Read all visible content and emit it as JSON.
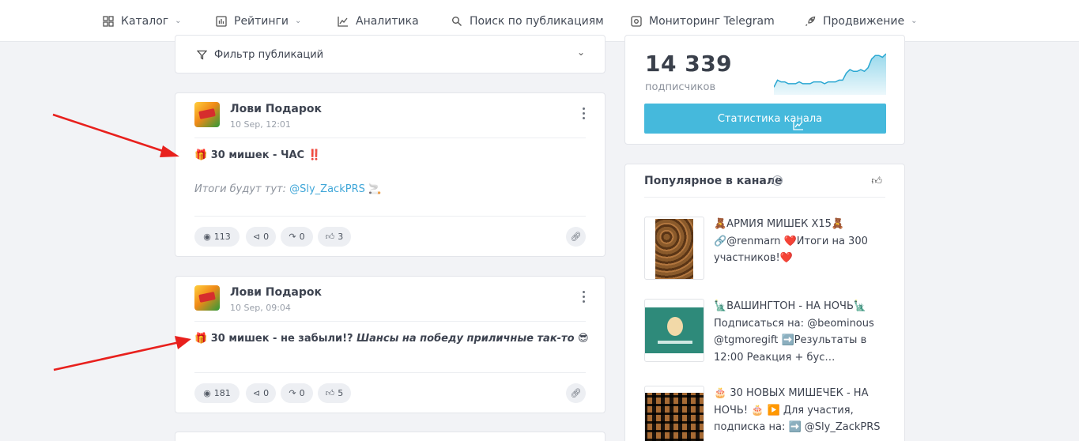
{
  "nav": {
    "items": [
      {
        "label": "Каталог",
        "icon": "grid-icon",
        "has_dropdown": true
      },
      {
        "label": "Рейтинги",
        "icon": "bar-chart-icon",
        "has_dropdown": true
      },
      {
        "label": "Аналитика",
        "icon": "line-chart-icon",
        "has_dropdown": false
      },
      {
        "label": "Поиск по публикациям",
        "icon": "search-icon",
        "has_dropdown": false
      },
      {
        "label": "Мониторинг Telegram",
        "icon": "monitor-icon",
        "has_dropdown": false
      },
      {
        "label": "Продвижение",
        "icon": "rocket-icon",
        "has_dropdown": true
      }
    ]
  },
  "filter": {
    "label": "Фильтр публикаций"
  },
  "posts": [
    {
      "channel": "Лови Подарок",
      "date": "10 Sep, 12:01",
      "line1_emoji": "🎁",
      "line1_text": "30 мишек - ЧАС",
      "line1_suffix": "‼️",
      "line2_text": "Итоги будут тут: ",
      "line2_link": "@Sly_ZackPRS",
      "line2_suffix": "🚬",
      "views": "113",
      "shares": "0",
      "forwards": "0",
      "reactions": "3"
    },
    {
      "channel": "Лови Подарок",
      "date": "10 Sep, 09:04",
      "line1_emoji": "🎁",
      "line1_text": "30 мишек - не забыли!?",
      "line1_italic": "Шансы на победу приличные так-то",
      "line1_suffix": "😎",
      "views": "181",
      "shares": "0",
      "forwards": "0",
      "reactions": "5"
    }
  ],
  "subscribers": {
    "count": "14 339",
    "label": "подписчиков",
    "button_label": "Статистика канала",
    "sparkline": [
      3,
      7,
      6,
      6,
      5,
      5,
      5,
      6,
      5,
      5,
      5,
      6,
      6,
      6,
      5,
      6,
      6,
      6,
      7,
      7,
      11,
      13,
      12,
      12,
      13,
      12,
      14,
      19,
      21,
      21,
      20,
      22
    ]
  },
  "popular": {
    "title": "Популярное в канале",
    "items": [
      {
        "text": "🧸АРМИЯ МИШЕК X15🧸 🔗@renmarn ❤️Итоги на 300 участников!❤️"
      },
      {
        "text": "🗽ВАШИНГТОН - НА НОЧЬ🗽 Подписаться на: @beominous @tgmoregift ➡️Результаты в 12:00 Реакция + бус…"
      },
      {
        "text": "🎂 30 НОВЫХ МИШЕЧЕК - НА НОЧЬ! 🎂 ▶️ Для участия, подписка на: ➡️ @Sly_ZackPRS"
      }
    ]
  },
  "colors": {
    "accent": "#45b9dc",
    "arrow": "#e8201d",
    "link": "#3fa6d8"
  }
}
